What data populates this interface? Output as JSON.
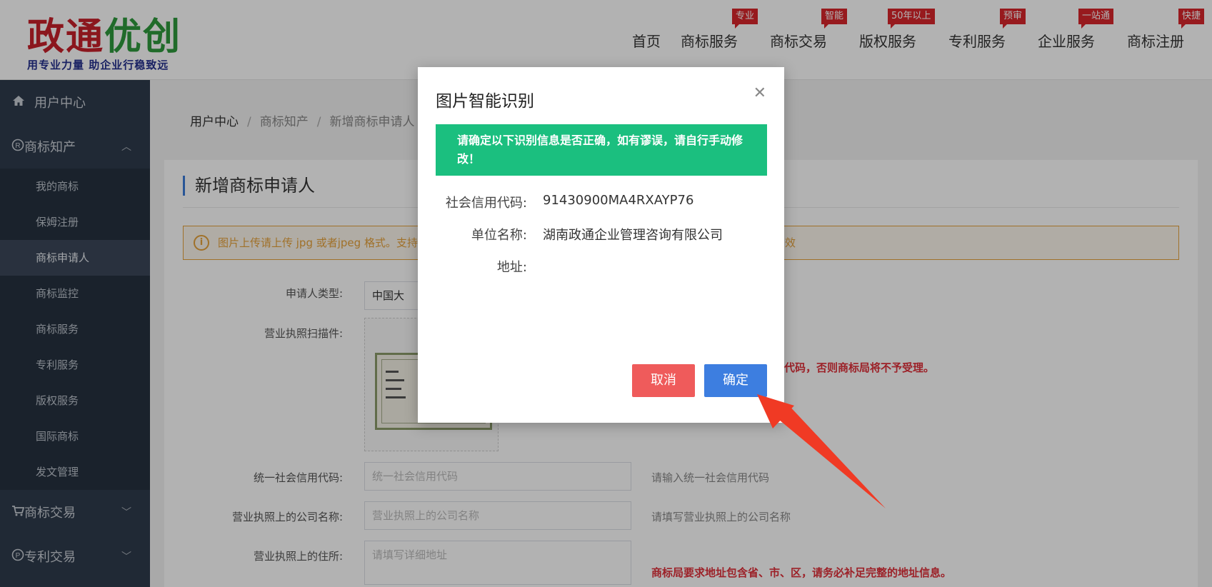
{
  "header": {
    "logo": {
      "title_part1": "政通",
      "title_part2": "优创",
      "slogan": "用专业力量  助企业行稳致远"
    },
    "nav": [
      {
        "label": "首页",
        "tag": ""
      },
      {
        "label": "商标服务",
        "tag": "专业"
      },
      {
        "label": "商标交易",
        "tag": "智能"
      },
      {
        "label": "版权服务",
        "tag": "50年以上"
      },
      {
        "label": "专利服务",
        "tag": "预审"
      },
      {
        "label": "企业服务",
        "tag": "一站通"
      },
      {
        "label": "商标注册",
        "tag": "快捷"
      }
    ]
  },
  "sidebar": {
    "user_center": "用户中心",
    "groups": [
      {
        "label": "商标知产",
        "icon": "registered-icon"
      },
      {
        "label": "商标交易",
        "icon": "cart-icon"
      },
      {
        "label": "专利交易",
        "icon": "patent-icon"
      }
    ],
    "sub_items": [
      "我的商标",
      "保姆注册",
      "商标申请人",
      "商标监控",
      "商标服务",
      "专利服务",
      "版权服务",
      "国际商标",
      "发文管理"
    ]
  },
  "breadcrumb": [
    "用户中心",
    "商标知产",
    "新增商标申请人"
  ],
  "card": {
    "title": "新增商标申请人",
    "notice": "图片上传请上传 jpg 或者jpeg 格式。支持",
    "notice_tail": "效",
    "applicant_type_label": "申请人类型:",
    "applicant_type_value": "中国大",
    "license_label": "营业执照扫描件:",
    "credit_code_label": "统一社会信用代码:",
    "credit_code_placeholder": "统一社会信用代码",
    "credit_code_hint": "请输入统一社会信用代码",
    "company_name_label": "营业执照上的公司名称:",
    "company_name_placeholder": "营业执照上的公司名称",
    "company_name_hint": "请填写营业执照上的公司名称",
    "address_label": "营业执照上的住所:",
    "address_placeholder": "请填写详细地址",
    "address_warn": "商标局要求地址包含省、市、区，请务必补足完整的地址信息。",
    "license_warn": "代码，否则商标局将不予受理。"
  },
  "modal": {
    "title": "图片智能识别",
    "alert": "请确定以下识别信息是否正确，如有谬误，请自行手动修改！",
    "fields": [
      {
        "label": "社会信用代码:",
        "value": "91430900MA4RXAYP76"
      },
      {
        "label": "单位名称:",
        "value": "湖南政通企业管理咨询有限公司"
      },
      {
        "label": "地址:",
        "value": ""
      }
    ],
    "cancel": "取消",
    "confirm": "确定"
  },
  "colors": {
    "accent_green": "#1bbf7f",
    "confirm_blue": "#3d7ee0",
    "cancel_red": "#ef5b5b",
    "sidebar_bg": "#2f3b4c",
    "arrow_red": "#f03a24"
  }
}
